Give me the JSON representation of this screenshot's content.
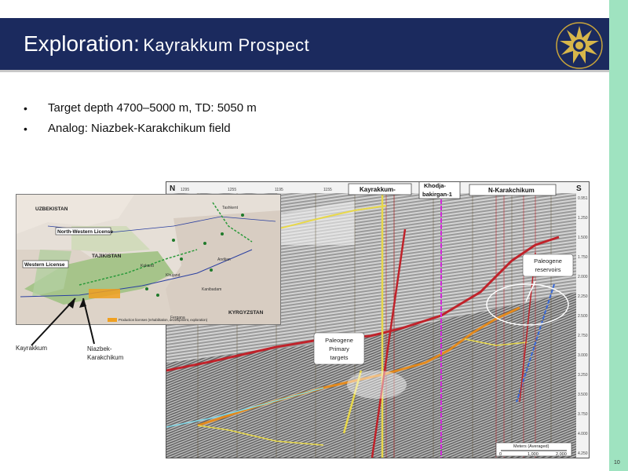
{
  "slide": {
    "title_main": "Exploration:",
    "title_sub": "Kayrakkum Prospect",
    "page_number": "10",
    "bullets": [
      "Target depth 4700–5000 m, TD: 5050 m",
      "Analog: Niazbek-Karakchikum field"
    ]
  },
  "map": {
    "countries": [
      "UZBEKISTAN",
      "TAJIKISTAN",
      "KYRGYZSTAN"
    ],
    "licenses": [
      "North-Western License",
      "Western License"
    ],
    "legend": "Production licenses (rehabilitation, development, exploration)",
    "place_labels": [
      "Tashkent",
      "Andijan",
      "Kokand",
      "Khujand",
      "Kanibadam",
      "Fergana"
    ],
    "callouts": [
      "Kayrakkum",
      "Niazbek-\nKarakchikum"
    ]
  },
  "seismic": {
    "compass_left": "N",
    "compass_right": "S",
    "well_labels": [
      "Kayrakkum-",
      "Khodja-\nbakirgan-1",
      "N-Karakchikum"
    ],
    "annotations": [
      "Paleogene\nreservoirs",
      "Paleogene\nPrimary\ntargets"
    ],
    "depth_ticks": [
      "0.951",
      "1.250",
      "1.500",
      "1.750",
      "2.000",
      "2.250",
      "2.500",
      "2.750",
      "3.000",
      "3.250",
      "3.500",
      "3.750",
      "4.000",
      "4.250"
    ],
    "trace_ticks": [
      "1295",
      "1255",
      "1195",
      "1155"
    ],
    "scale_title": "Meters (Averaged)",
    "scale_values": [
      "0",
      "1,000",
      "2,000"
    ]
  },
  "colors": {
    "header_bg": "#1b2a5e",
    "side_bar": "#9fe3c0",
    "horizon_red": "#c0222a",
    "horizon_yellow": "#e8d84a",
    "horizon_orange": "#e38a1e",
    "horizon_cyan": "#7fd8e8",
    "well_magenta": "#d02ad8"
  }
}
